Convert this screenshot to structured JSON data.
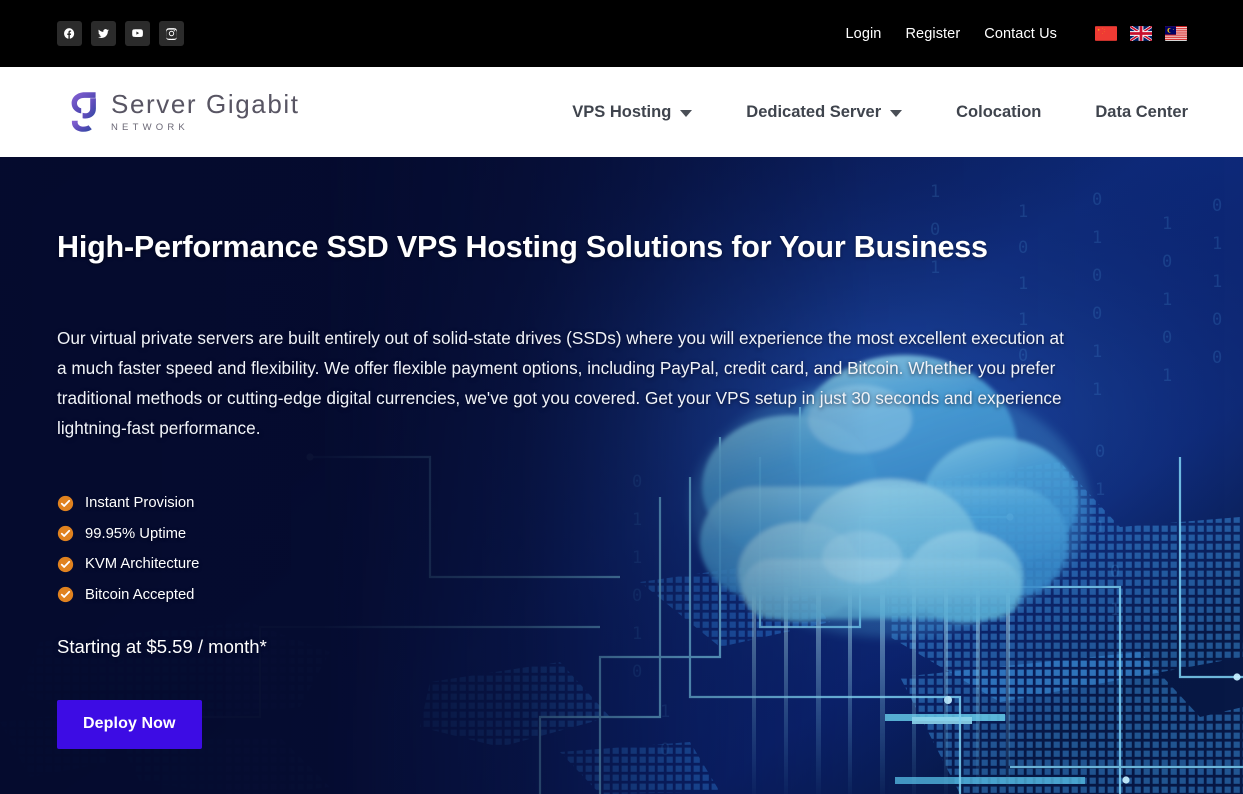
{
  "topbar": {
    "social": [
      {
        "name": "facebook-icon",
        "label": "Facebook"
      },
      {
        "name": "twitter-icon",
        "label": "Twitter"
      },
      {
        "name": "youtube-icon",
        "label": "YouTube"
      },
      {
        "name": "instagram-icon",
        "label": "Instagram"
      }
    ],
    "links": [
      {
        "label": "Login"
      },
      {
        "label": "Register"
      },
      {
        "label": "Contact Us"
      }
    ],
    "flags": [
      {
        "label": "Chinese",
        "code": "cn"
      },
      {
        "label": "English",
        "code": "gb"
      },
      {
        "label": "Malay",
        "code": "my"
      }
    ],
    "bg_color": "#000000"
  },
  "header": {
    "logo": {
      "name": "Server Gigabit",
      "subtitle": "NETWORK",
      "mark_color_start": "#7b5fd4",
      "mark_color_end": "#2f4fa8"
    },
    "nav": [
      {
        "label": "VPS Hosting",
        "has_dropdown": true
      },
      {
        "label": "Dedicated Server",
        "has_dropdown": true
      },
      {
        "label": "Colocation",
        "has_dropdown": false
      },
      {
        "label": "Data Center",
        "has_dropdown": false
      }
    ],
    "bg_color": "#ffffff",
    "text_color": "#3f444d"
  },
  "hero": {
    "title": "High-Performance SSD VPS Hosting Solutions for Your Business",
    "paragraph": "Our virtual private servers are built entirely out of solid-state drives (SSDs) where you will experience the most excellent execution at a much faster speed and flexibility. We offer flexible payment options, including PayPal, credit card, and Bitcoin. Whether you prefer traditional methods or cutting-edge digital currencies, we've got you covered. Get your VPS setup in just 30 seconds and experience lightning-fast performance.",
    "features": [
      {
        "label": "Instant Provision"
      },
      {
        "label": "99.95% Uptime"
      },
      {
        "label": "KVM Architecture"
      },
      {
        "label": "Bitcoin Accepted"
      }
    ],
    "price": "Starting at $5.59 / month*",
    "cta_label": "Deploy Now",
    "cta_color": "#3d0ce4",
    "check_color": "#e0821f",
    "bg_color": "#050b2e",
    "accent_color": "#1e7fe0"
  }
}
